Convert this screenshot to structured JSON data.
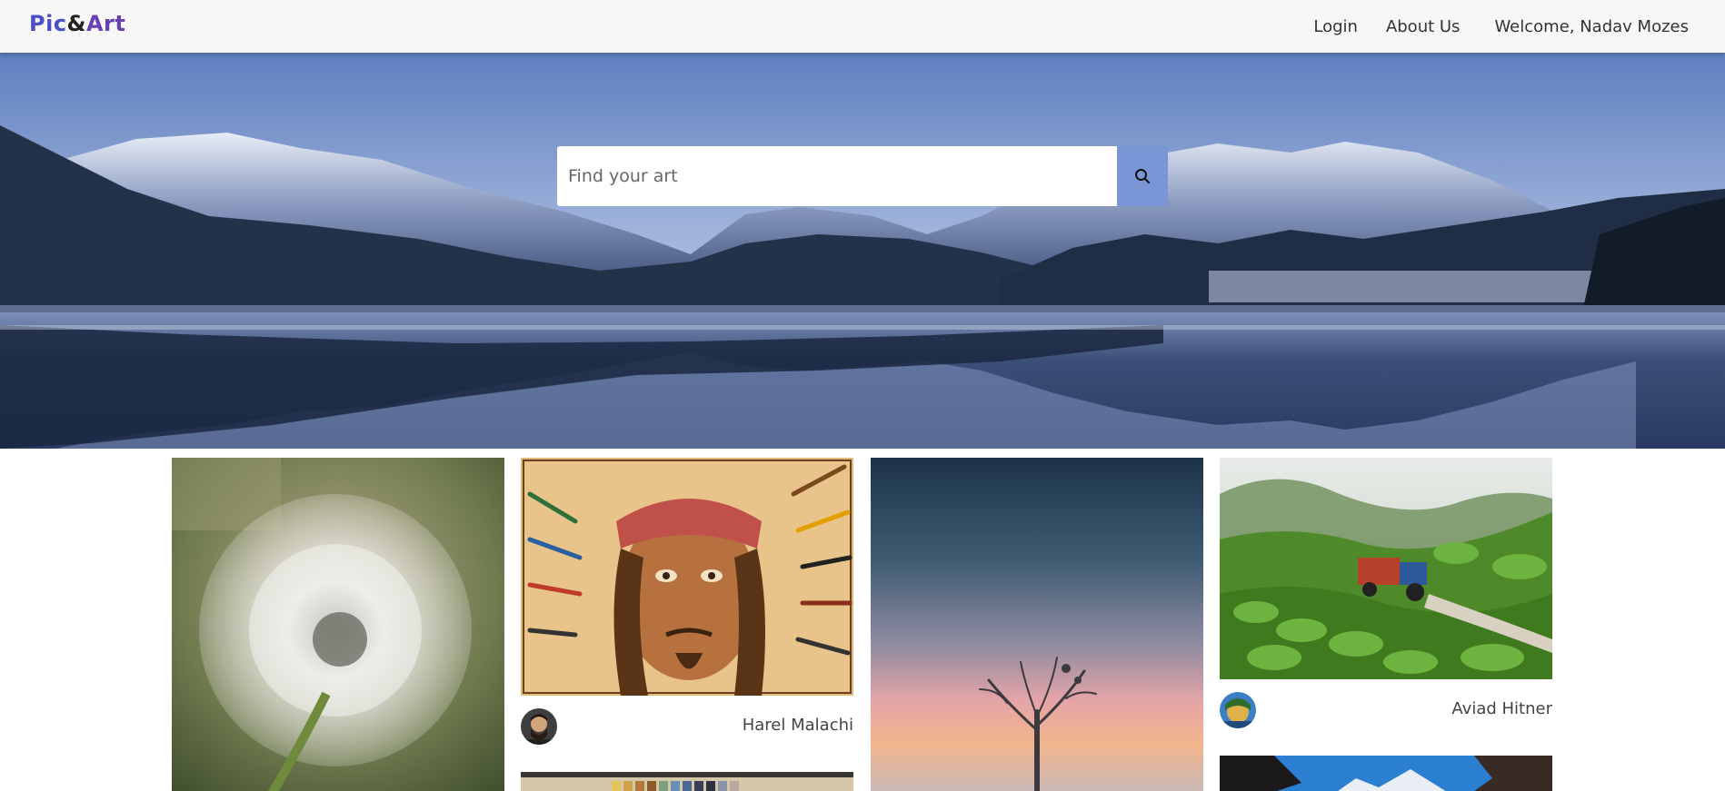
{
  "navbar": {
    "logo": {
      "part1": "Pic",
      "amp": "&",
      "part2": "Art"
    },
    "links": {
      "login": "Login",
      "about": "About Us",
      "welcome": "Welcome, Nadav Mozes"
    }
  },
  "search": {
    "placeholder": "Find your art",
    "button_icon": "search-icon"
  },
  "gallery": {
    "cards": [
      {
        "image": "dandelion",
        "author": ""
      },
      {
        "image": "pirate-portrait-drawing",
        "author": "Harel Malachi",
        "avatar": "avatar-harel"
      },
      {
        "image": "colored-pencils",
        "author": ""
      },
      {
        "image": "foggy-tree-sunset",
        "author": ""
      },
      {
        "image": "tea-plantation-tractor",
        "author": "Aviad Hitner",
        "avatar": "avatar-aviad"
      },
      {
        "image": "snowy-mountains",
        "author": ""
      }
    ]
  }
}
